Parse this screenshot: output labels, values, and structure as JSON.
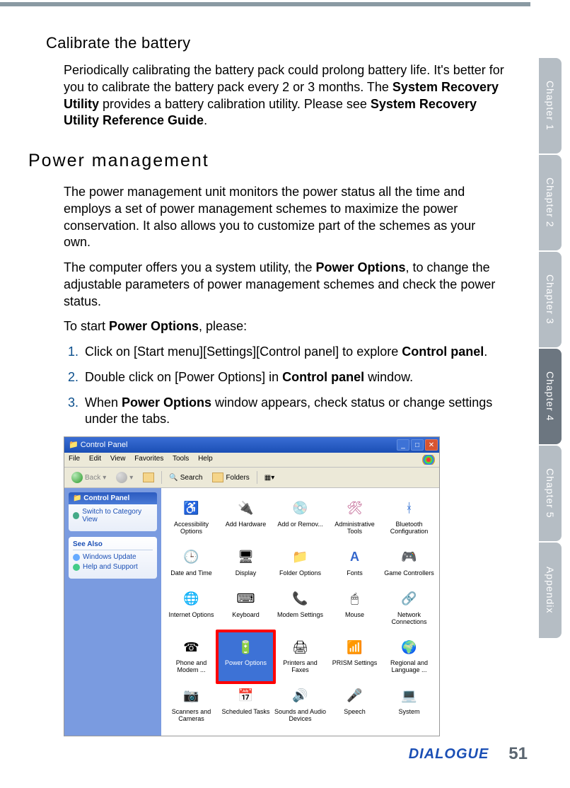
{
  "headings": {
    "calibrate": "Calibrate the battery",
    "power": "Power management"
  },
  "paragraphs": {
    "p1_a": "Periodically calibrating the battery pack could prolong battery life. It's better for you to calibrate the battery pack every 2 or 3 months. The ",
    "p1_b": "System Recovery Utility",
    "p1_c": " provides a battery calibration utility. Please see ",
    "p1_d": "System Recovery Utility Reference Guide",
    "p1_e": ".",
    "p2": "The power management unit monitors the power status all the time and employs a set of power management schemes to maximize the power conservation. It also allows you to customize part of the schemes as your own.",
    "p3_a": "The computer offers you a system utility, the ",
    "p3_b": "Power Options",
    "p3_c": ", to change the adjustable parameters of power management schemes and check the power status.",
    "p4_a": "To start ",
    "p4_b": "Power Options",
    "p4_c": ", please:"
  },
  "steps": {
    "s1_a": "Click on [Start menu][Settings][Control panel] to explore ",
    "s1_b": "Control panel",
    "s1_c": ".",
    "s2_a": "Double click on [Power Options] in ",
    "s2_b": "Control panel",
    "s2_c": " window.",
    "s3_a": "When ",
    "s3_b": "Power Options",
    "s3_c": " window appears, check status or change settings under the tabs."
  },
  "screenshot": {
    "title": "Control Panel",
    "menu": {
      "file": "File",
      "edit": "Edit",
      "view": "View",
      "favorites": "Favorites",
      "tools": "Tools",
      "help": "Help"
    },
    "toolbar": {
      "back": "Back",
      "search": "Search",
      "folders": "Folders"
    },
    "side": {
      "panel_title": "Control Panel",
      "switch": "Switch to Category View",
      "see_also": "See Also",
      "windows_update": "Windows Update",
      "help_support": "Help and Support"
    },
    "icons": {
      "r1": [
        "Accessibility Options",
        "Add Hardware",
        "Add or Remov...",
        "Administrative Tools",
        "Bluetooth Configuration"
      ],
      "r2": [
        "Date and Time",
        "Display",
        "Folder Options",
        "Fonts",
        "Game Controllers"
      ],
      "r3": [
        "Internet Options",
        "Keyboard",
        "Modem Settings",
        "Mouse",
        "Network Connections"
      ],
      "r4": [
        "Phone and Modem ...",
        "Power Options",
        "Printers and Faxes",
        "PRISM Settings",
        "Regional and Language ..."
      ],
      "r5": [
        "Scanners and Cameras",
        "Scheduled Tasks",
        "Sounds and Audio Devices",
        "Speech",
        "System"
      ]
    }
  },
  "tabs": [
    "Chapter 1",
    "Chapter 2",
    "Chapter 3",
    "Chapter 4",
    "Chapter 5",
    "Appendix"
  ],
  "active_tab_index": 3,
  "footer": {
    "brand": "DIALOGUE",
    "page": "51"
  }
}
